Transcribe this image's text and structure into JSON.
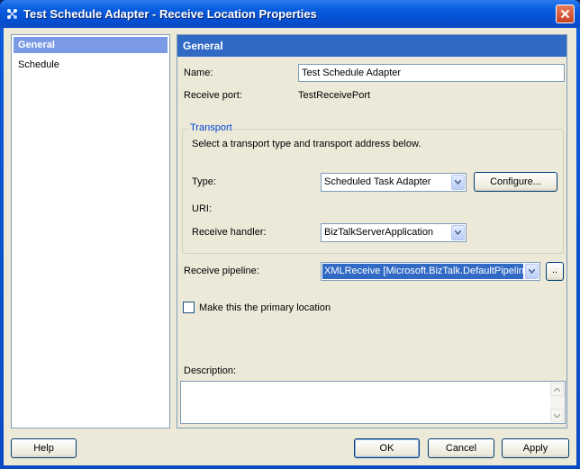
{
  "window": {
    "title": "Test Schedule Adapter - Receive Location Properties",
    "close_label": "X"
  },
  "nav": {
    "items": [
      {
        "label": "General",
        "selected": true
      },
      {
        "label": "Schedule",
        "selected": false
      }
    ]
  },
  "panel": {
    "header": "General",
    "name_label": "Name:",
    "name_value": "Test Schedule Adapter",
    "receive_port_label": "Receive port:",
    "receive_port_value": "TestReceivePort",
    "transport": {
      "title": "Transport",
      "instructions": "Select a transport type and transport address below.",
      "type_label": "Type:",
      "type_value": "Scheduled Task Adapter",
      "configure_label": "Configure...",
      "uri_label": "URI:",
      "handler_label": "Receive handler:",
      "handler_value": "BizTalkServerApplication"
    },
    "pipeline_label": "Receive pipeline:",
    "pipeline_value": "XMLReceive      [Microsoft.BizTalk.DefaultPipelines.XMLReceive]",
    "pipeline_browse_label": "..",
    "primary_location_label": "Make this the primary location",
    "primary_location_checked": false,
    "description_label": "Description:",
    "description_value": ""
  },
  "footer": {
    "help": "Help",
    "ok": "OK",
    "cancel": "Cancel",
    "apply": "Apply"
  }
}
